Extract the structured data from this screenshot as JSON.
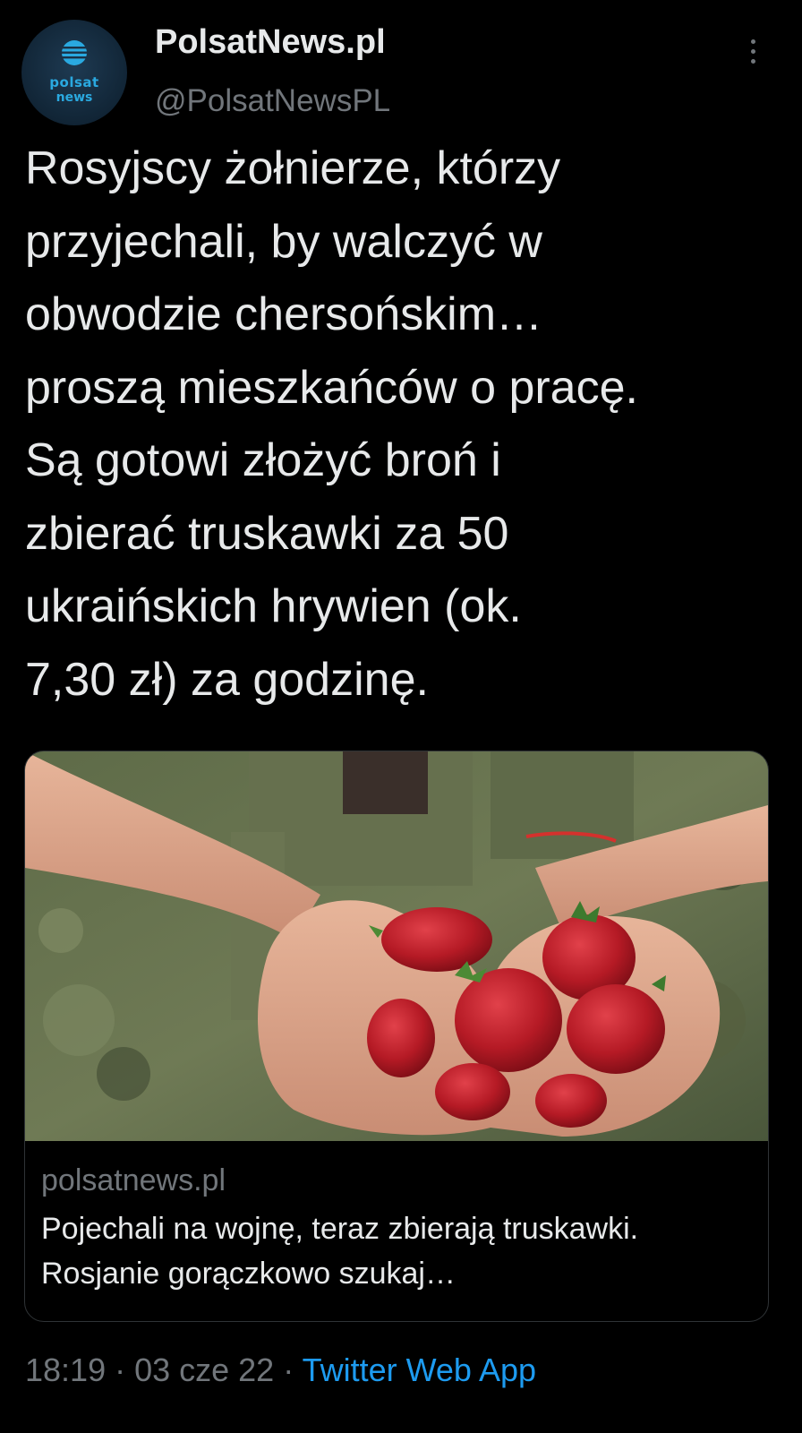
{
  "account": {
    "display_name": "PolsatNews.pl",
    "handle": "@PolsatNewsPL",
    "avatar_line1": "polsat",
    "avatar_line2": "news",
    "avatar_icon": "globe-stripes-icon"
  },
  "tweet": {
    "text": "Rosyjscy żołnierze, którzy\nprzyjechali, by walczyć w\nobwodzie chersońskim…\nproszą mieszkańców o pracę.\nSą gotowi złożyć broń i\nzbierać truskawki za 50\nukraińskich hrywien (ok.\n7,30 zł) za godzinę."
  },
  "card": {
    "image_subject": "hands holding strawberries, camouflage uniform",
    "domain": "polsatnews.pl",
    "title": "Pojechali na wojnę, teraz zbierają truskawki. Rosjanie gorączkowo szukaj…"
  },
  "meta": {
    "time": "18:19",
    "sep1": " · ",
    "date": "03 cze 22",
    "sep2": " · ",
    "source": "Twitter Web App"
  },
  "colors": {
    "background": "#000000",
    "text": "#e7e9ea",
    "secondary": "#71767b",
    "link": "#1d9bf0",
    "brand": "#2aa9e0"
  }
}
